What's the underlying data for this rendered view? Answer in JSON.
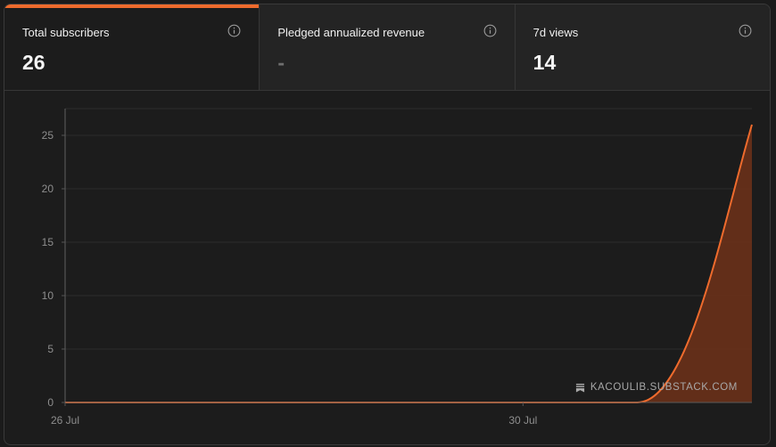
{
  "tabs": [
    {
      "label": "Total subscribers",
      "value": "26",
      "active": true,
      "icon": "info-icon"
    },
    {
      "label": "Pledged annualized revenue",
      "value": "-",
      "active": false,
      "icon": "info-icon"
    },
    {
      "label": "7d views",
      "value": "14",
      "active": false,
      "icon": "info-icon"
    }
  ],
  "watermark": {
    "text": "KACOULIB.SUBSTACK.COM",
    "icon": "substack-logo-icon"
  },
  "colors": {
    "accent": "#ef6b2d",
    "area_fill": "#6a3119",
    "background": "#1c1c1c",
    "grid": "#2d2d2d"
  },
  "chart_data": {
    "type": "area",
    "title": "",
    "xlabel": "",
    "ylabel": "",
    "x_ticks": [
      "26 Jul",
      "30 Jul"
    ],
    "y_ticks": [
      0,
      5,
      10,
      15,
      20,
      25
    ],
    "ylim": [
      0,
      27.5
    ],
    "xlim": [
      "26 Jul",
      "1 Aug"
    ],
    "grid": true,
    "series": [
      {
        "x": [
          "26 Jul",
          "27 Jul",
          "28 Jul",
          "29 Jul",
          "30 Jul",
          "31 Jul",
          "1 Aug"
        ],
        "values": [
          0,
          0,
          0,
          0,
          0,
          0,
          26
        ]
      }
    ]
  }
}
